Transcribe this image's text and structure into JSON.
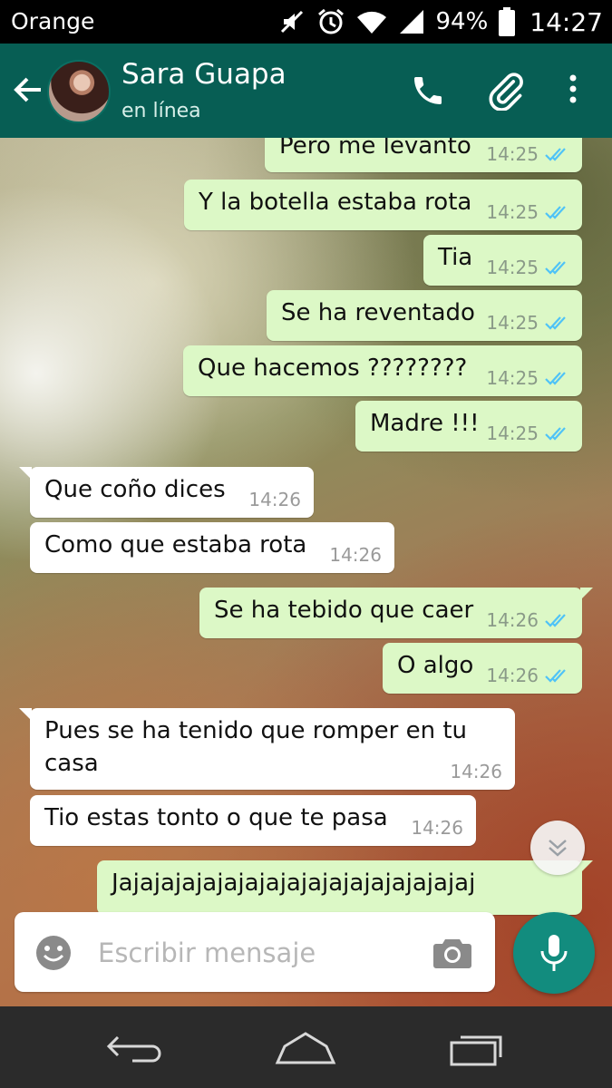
{
  "status_bar": {
    "carrier": "Orange",
    "battery": "94%",
    "time": "14:27",
    "icons": [
      "mute-icon",
      "alarm-icon",
      "wifi-icon",
      "signal-icon",
      "battery-icon"
    ]
  },
  "header": {
    "contact_name": "Sara Guapa",
    "contact_status": "en línea",
    "icons": [
      "back-arrow-icon",
      "avatar",
      "phone-icon",
      "paperclip-icon",
      "more-vert-icon"
    ]
  },
  "colors": {
    "header": "#075e54",
    "outgoing_bubble": "#dcf8c6",
    "incoming_bubble": "#ffffff",
    "read_ticks": "#4fc3f7",
    "mic_button": "#128c7e"
  },
  "messages": [
    {
      "dir": "out",
      "text": "Pero me levanto",
      "time": "14:25",
      "read": true
    },
    {
      "dir": "out",
      "text": "Y la botella estaba rota",
      "time": "14:25",
      "read": true
    },
    {
      "dir": "out",
      "text": "Tia",
      "time": "14:25",
      "read": true
    },
    {
      "dir": "out",
      "text": "Se ha reventado",
      "time": "14:25",
      "read": true
    },
    {
      "dir": "out",
      "text": "Que hacemos ????????",
      "time": "14:25",
      "read": true
    },
    {
      "dir": "out",
      "text": "Madre !!!",
      "time": "14:25",
      "read": true
    },
    {
      "dir": "in",
      "text": "Que coño dices",
      "time": "14:26"
    },
    {
      "dir": "in",
      "text": "Como que estaba rota",
      "time": "14:26"
    },
    {
      "dir": "out",
      "text": "Se ha tebido que caer",
      "time": "14:26",
      "read": true
    },
    {
      "dir": "out",
      "text": "O algo",
      "time": "14:26",
      "read": true
    },
    {
      "dir": "in",
      "text_line1": "Pues se ha tenido que romper en tu",
      "text_line2": "casa",
      "time": "14:26"
    },
    {
      "dir": "in",
      "text": "Tio estas tonto o que te pasa",
      "time": "14:26"
    },
    {
      "dir": "out",
      "text": "Jajajajajajajajajajajajajajajajajaj"
    }
  ],
  "composer": {
    "placeholder": "Escribir mensaje"
  }
}
